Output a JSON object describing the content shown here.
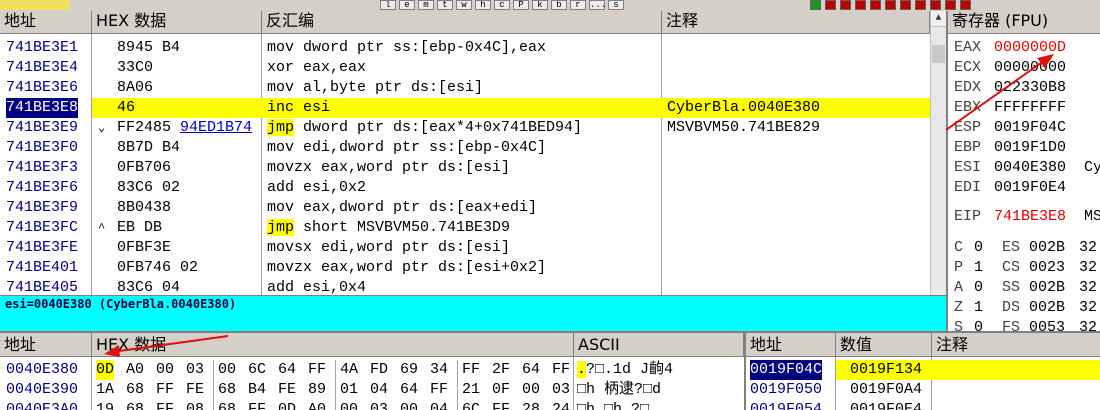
{
  "toolbar": {
    "letters": [
      "l",
      "e",
      "m",
      "t",
      "w",
      "h",
      "c",
      "P",
      "k",
      "b",
      "r",
      "...",
      "s"
    ],
    "icon_colors": [
      "#1a9a1a",
      "#c00000",
      "#c00000",
      "#c00000",
      "#c00000",
      "#c00000",
      "#c00000",
      "#c00000",
      "#c00000",
      "#c00000",
      "#c00000"
    ]
  },
  "disasm": {
    "headers": {
      "addr": "地址",
      "hex": "HEX 数据",
      "asm": "反汇编",
      "comment": "注释"
    },
    "rows": [
      {
        "addr": "741BE3E1",
        "mark": "",
        "hex": "8945 B4",
        "hex_link": "",
        "kw": "",
        "asm": "mov dword ptr ss:[ebp-0x4C],eax",
        "comment": ""
      },
      {
        "addr": "741BE3E4",
        "mark": "",
        "hex": "33C0",
        "hex_link": "",
        "kw": "",
        "asm": "xor eax,eax",
        "comment": ""
      },
      {
        "addr": "741BE3E6",
        "mark": "",
        "hex": "8A06",
        "hex_link": "",
        "kw": "",
        "asm": "mov al,byte ptr ds:[esi]",
        "comment": ""
      },
      {
        "addr": "741BE3E8",
        "mark": "",
        "hex": "46",
        "hex_link": "",
        "kw": "",
        "asm": "inc esi",
        "comment": "CyberBla.0040E380",
        "selected": true
      },
      {
        "addr": "741BE3E9",
        "mark": "⌄",
        "hex": "FF2485 ",
        "hex_link": "94ED1B74",
        "kw": "jmp",
        "asm": " dword ptr ds:[eax*4+0x741BED94]",
        "comment": "MSVBVM50.741BE829"
      },
      {
        "addr": "741BE3F0",
        "mark": "",
        "hex": "8B7D B4",
        "hex_link": "",
        "kw": "",
        "asm": "mov edi,dword ptr ss:[ebp-0x4C]",
        "comment": ""
      },
      {
        "addr": "741BE3F3",
        "mark": "",
        "hex": "0FB706",
        "hex_link": "",
        "kw": "",
        "asm": "movzx eax,word ptr ds:[esi]",
        "comment": ""
      },
      {
        "addr": "741BE3F6",
        "mark": "",
        "hex": "83C6 02",
        "hex_link": "",
        "kw": "",
        "asm": "add esi,0x2",
        "comment": ""
      },
      {
        "addr": "741BE3F9",
        "mark": "",
        "hex": "8B0438",
        "hex_link": "",
        "kw": "",
        "asm": "mov eax,dword ptr ds:[eax+edi]",
        "comment": ""
      },
      {
        "addr": "741BE3FC",
        "mark": "^",
        "hex": "EB DB",
        "hex_link": "",
        "kw": "jmp",
        "asm": " short MSVBVM50.741BE3D9",
        "comment": ""
      },
      {
        "addr": "741BE3FE",
        "mark": "",
        "hex": "0FBF3E",
        "hex_link": "",
        "kw": "",
        "asm": "movsx edi,word ptr ds:[esi]",
        "comment": ""
      },
      {
        "addr": "741BE401",
        "mark": "",
        "hex": "0FB746 02",
        "hex_link": "",
        "kw": "",
        "asm": "movzx eax,word ptr ds:[esi+0x2]",
        "comment": ""
      },
      {
        "addr": "741BE405",
        "mark": "",
        "hex": "83C6 04",
        "hex_link": "",
        "kw": "",
        "asm": "add esi,0x4",
        "comment": ""
      }
    ]
  },
  "info_line": "esi=0040E380 (CyberBla.0040E380)",
  "registers": {
    "header": "寄存器 (FPU)",
    "gp": [
      {
        "name": "EAX",
        "value": "0000000D",
        "extra": "",
        "changed": true
      },
      {
        "name": "ECX",
        "value": "00000000",
        "extra": "",
        "changed": false
      },
      {
        "name": "EDX",
        "value": "022330B8",
        "extra": "",
        "changed": false
      },
      {
        "name": "EBX",
        "value": "FFFFFFFF",
        "extra": "",
        "changed": false
      },
      {
        "name": "ESP",
        "value": "0019F04C",
        "extra": "",
        "changed": false
      },
      {
        "name": "EBP",
        "value": "0019F1D0",
        "extra": "",
        "changed": false
      },
      {
        "name": "ESI",
        "value": "0040E380",
        "extra": "Cy",
        "changed": false
      },
      {
        "name": "EDI",
        "value": "0019F0E4",
        "extra": "",
        "changed": false
      }
    ],
    "eip": {
      "name": "EIP",
      "value": "741BE3E8",
      "extra": "MS"
    },
    "flags": [
      {
        "flag": "C",
        "val": "0",
        "seg": "ES",
        "sval": "002B",
        "bits": "32"
      },
      {
        "flag": "P",
        "val": "1",
        "seg": "CS",
        "sval": "0023",
        "bits": "32"
      },
      {
        "flag": "A",
        "val": "0",
        "seg": "SS",
        "sval": "002B",
        "bits": "32"
      },
      {
        "flag": "Z",
        "val": "1",
        "seg": "DS",
        "sval": "002B",
        "bits": "32"
      },
      {
        "flag": "S",
        "val": "0",
        "seg": "FS",
        "sval": "0053",
        "bits": "32"
      }
    ]
  },
  "dump": {
    "headers": {
      "addr": "地址",
      "hex": "HEX 数据",
      "ascii": "ASCII"
    },
    "rows": [
      {
        "addr": "0040E380",
        "bytes": [
          "0D",
          "A0",
          "00",
          "03",
          "00",
          "6C",
          "64",
          "FF",
          "4A",
          "FD",
          "69",
          "34",
          "FF",
          "2F",
          "64",
          "FF"
        ],
        "ascii": ".?□.1d  J齣4",
        "ascii_hl": ".",
        "ascii_rest": "?□.1d  J齣4"
      },
      {
        "addr": "0040E390",
        "bytes": [
          "1A",
          "68",
          "FF",
          "FE",
          "68",
          "B4",
          "FE",
          "89",
          "01",
          "04",
          "64",
          "FF",
          "21",
          "0F",
          "00",
          "03"
        ],
        "ascii": "□h  柄逮?□d",
        "ascii_hl": "",
        "ascii_rest": "□h  柄逮?□d"
      },
      {
        "addr": "0040E3A0",
        "bytes": [
          "19",
          "68",
          "FF",
          "08",
          "68",
          "FF",
          "0D",
          "A0",
          "00",
          "03",
          "00",
          "04",
          "6C",
          "FF",
          "28",
          "24"
        ],
        "ascii": "□h  □h  ?□",
        "ascii_hl": "",
        "ascii_rest": "□h  □h  ?□"
      }
    ]
  },
  "stack": {
    "headers": {
      "addr": "地址",
      "value": "数值",
      "comment": "注释"
    },
    "rows": [
      {
        "addr": "0019F04C",
        "value": "0019F134",
        "selected": true
      },
      {
        "addr": "0019F050",
        "value": "0019F0A4",
        "selected": false
      },
      {
        "addr": "0019F054",
        "value": "0019F0E4",
        "selected": false
      }
    ]
  },
  "colors": {
    "highlight": "#ffff00",
    "info_bg": "#00ffff",
    "changed_reg": "#e00000",
    "addr_blue": "#000080",
    "arrow": "#e01010"
  }
}
